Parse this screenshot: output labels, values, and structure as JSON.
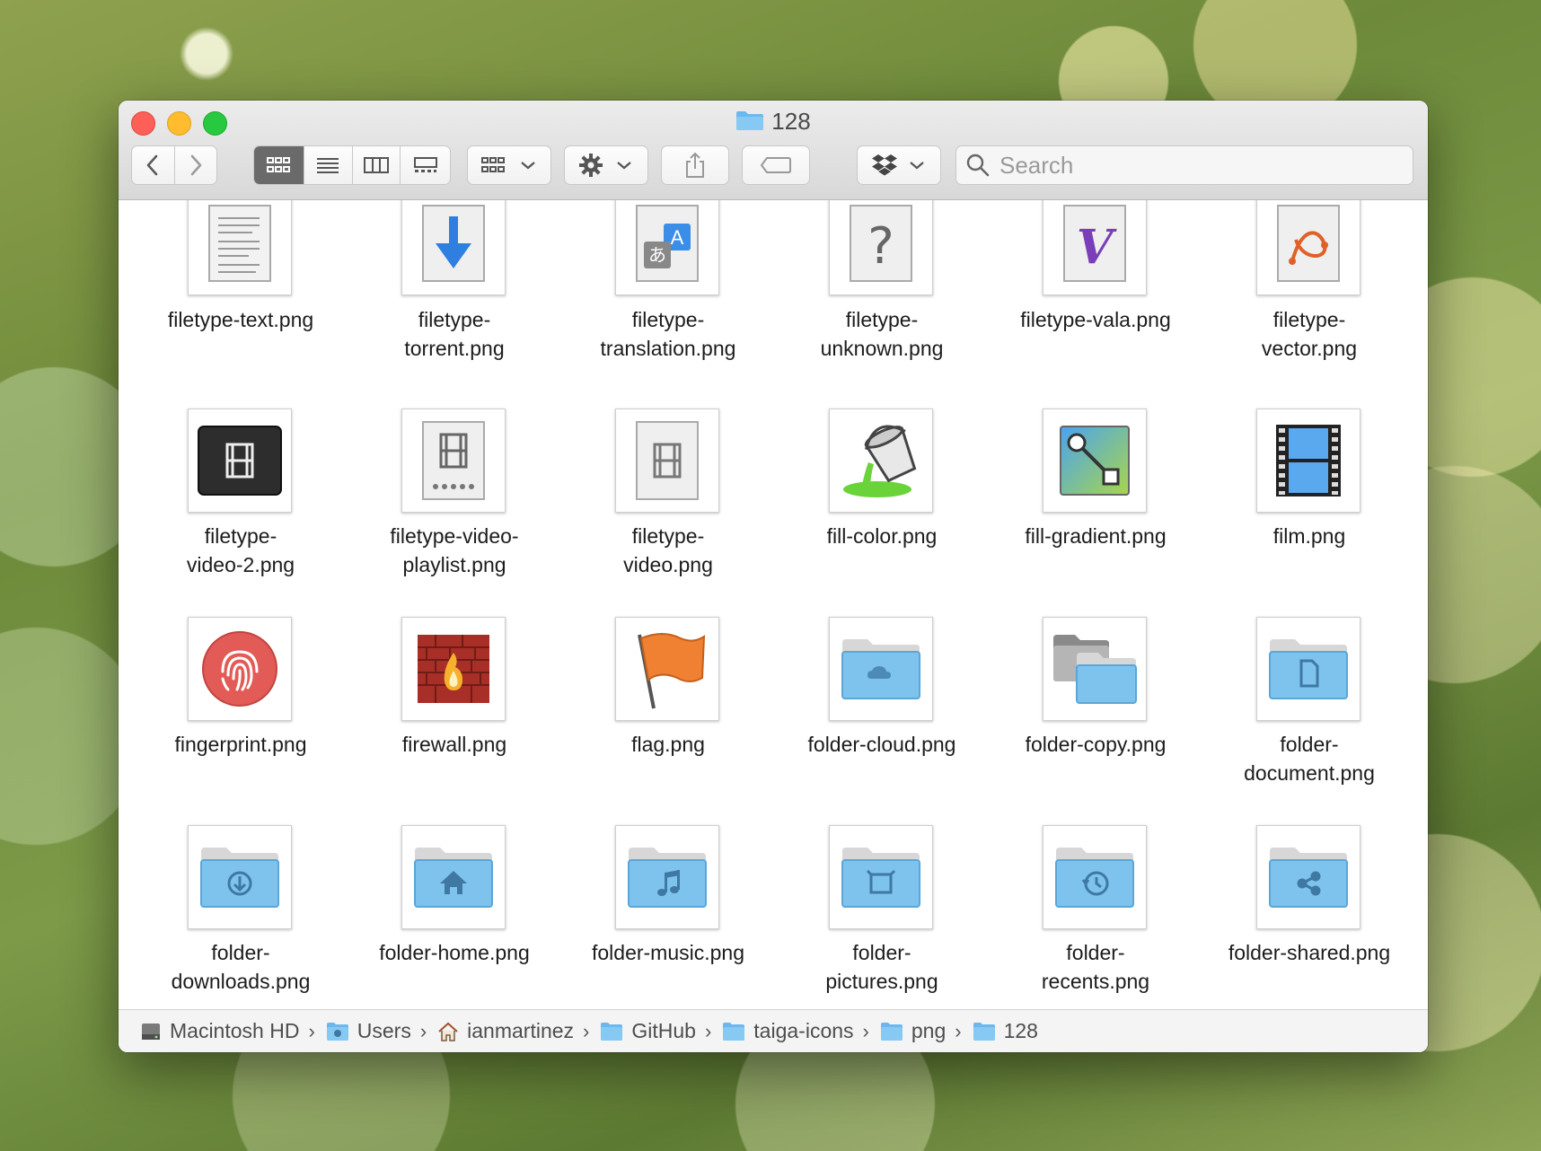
{
  "window": {
    "title": "128",
    "search_placeholder": "Search"
  },
  "items": [
    {
      "name": "filetype-text.png",
      "label": "filetype-text.png",
      "icon": "text-document-icon"
    },
    {
      "name": "filetype-torrent.png",
      "label": "filetype-\ntorrent.png",
      "icon": "torrent-icon"
    },
    {
      "name": "filetype-translation.png",
      "label": "filetype-\ntranslation.png",
      "icon": "translation-icon"
    },
    {
      "name": "filetype-unknown.png",
      "label": "filetype-\nunknown.png",
      "icon": "unknown-file-icon"
    },
    {
      "name": "filetype-vala.png",
      "label": "filetype-vala.png",
      "icon": "vala-icon"
    },
    {
      "name": "filetype-vector.png",
      "label": "filetype-\nvector.png",
      "icon": "vector-icon"
    },
    {
      "name": "filetype-video-2.png",
      "label": "filetype-\nvideo-2.png",
      "icon": "video-dark-icon"
    },
    {
      "name": "filetype-video-playlist.png",
      "label": "filetype-video-\nplaylist.png",
      "icon": "video-playlist-icon"
    },
    {
      "name": "filetype-video.png",
      "label": "filetype-\nvideo.png",
      "icon": "video-file-icon"
    },
    {
      "name": "fill-color.png",
      "label": "fill-color.png",
      "icon": "paint-bucket-icon"
    },
    {
      "name": "fill-gradient.png",
      "label": "fill-gradient.png",
      "icon": "gradient-icon"
    },
    {
      "name": "film.png",
      "label": "film.png",
      "icon": "film-strip-icon"
    },
    {
      "name": "fingerprint.png",
      "label": "fingerprint.png",
      "icon": "fingerprint-icon"
    },
    {
      "name": "firewall.png",
      "label": "firewall.png",
      "icon": "firewall-icon"
    },
    {
      "name": "flag.png",
      "label": "flag.png",
      "icon": "flag-icon"
    },
    {
      "name": "folder-cloud.png",
      "label": "folder-cloud.png",
      "icon": "folder-cloud-icon"
    },
    {
      "name": "folder-copy.png",
      "label": "folder-copy.png",
      "icon": "folder-copy-icon"
    },
    {
      "name": "folder-document.png",
      "label": "folder-\ndocument.png",
      "icon": "folder-document-icon"
    },
    {
      "name": "folder-downloads.png",
      "label": "folder-\ndownloads.png",
      "icon": "folder-downloads-icon"
    },
    {
      "name": "folder-home.png",
      "label": "folder-home.png",
      "icon": "folder-home-icon"
    },
    {
      "name": "folder-music.png",
      "label": "folder-music.png",
      "icon": "folder-music-icon"
    },
    {
      "name": "folder-pictures.png",
      "label": "folder-\npictures.png",
      "icon": "folder-pictures-icon"
    },
    {
      "name": "folder-recents.png",
      "label": "folder-\nrecents.png",
      "icon": "folder-recents-icon"
    },
    {
      "name": "folder-shared.png",
      "label": "folder-shared.png",
      "icon": "folder-shared-icon"
    }
  ],
  "path": [
    {
      "label": "Macintosh HD",
      "icon": "hard-drive-icon"
    },
    {
      "label": "Users",
      "icon": "users-folder-icon"
    },
    {
      "label": "ianmartinez",
      "icon": "home-icon"
    },
    {
      "label": "GitHub",
      "icon": "folder-icon"
    },
    {
      "label": "taiga-icons",
      "icon": "folder-icon"
    },
    {
      "label": "png",
      "icon": "folder-icon"
    },
    {
      "label": "128",
      "icon": "folder-icon"
    }
  ],
  "colors": {
    "folder_blue": "#7ec3ee",
    "close": "#fe5f57",
    "minimize": "#febc2e",
    "zoom": "#28c840"
  }
}
